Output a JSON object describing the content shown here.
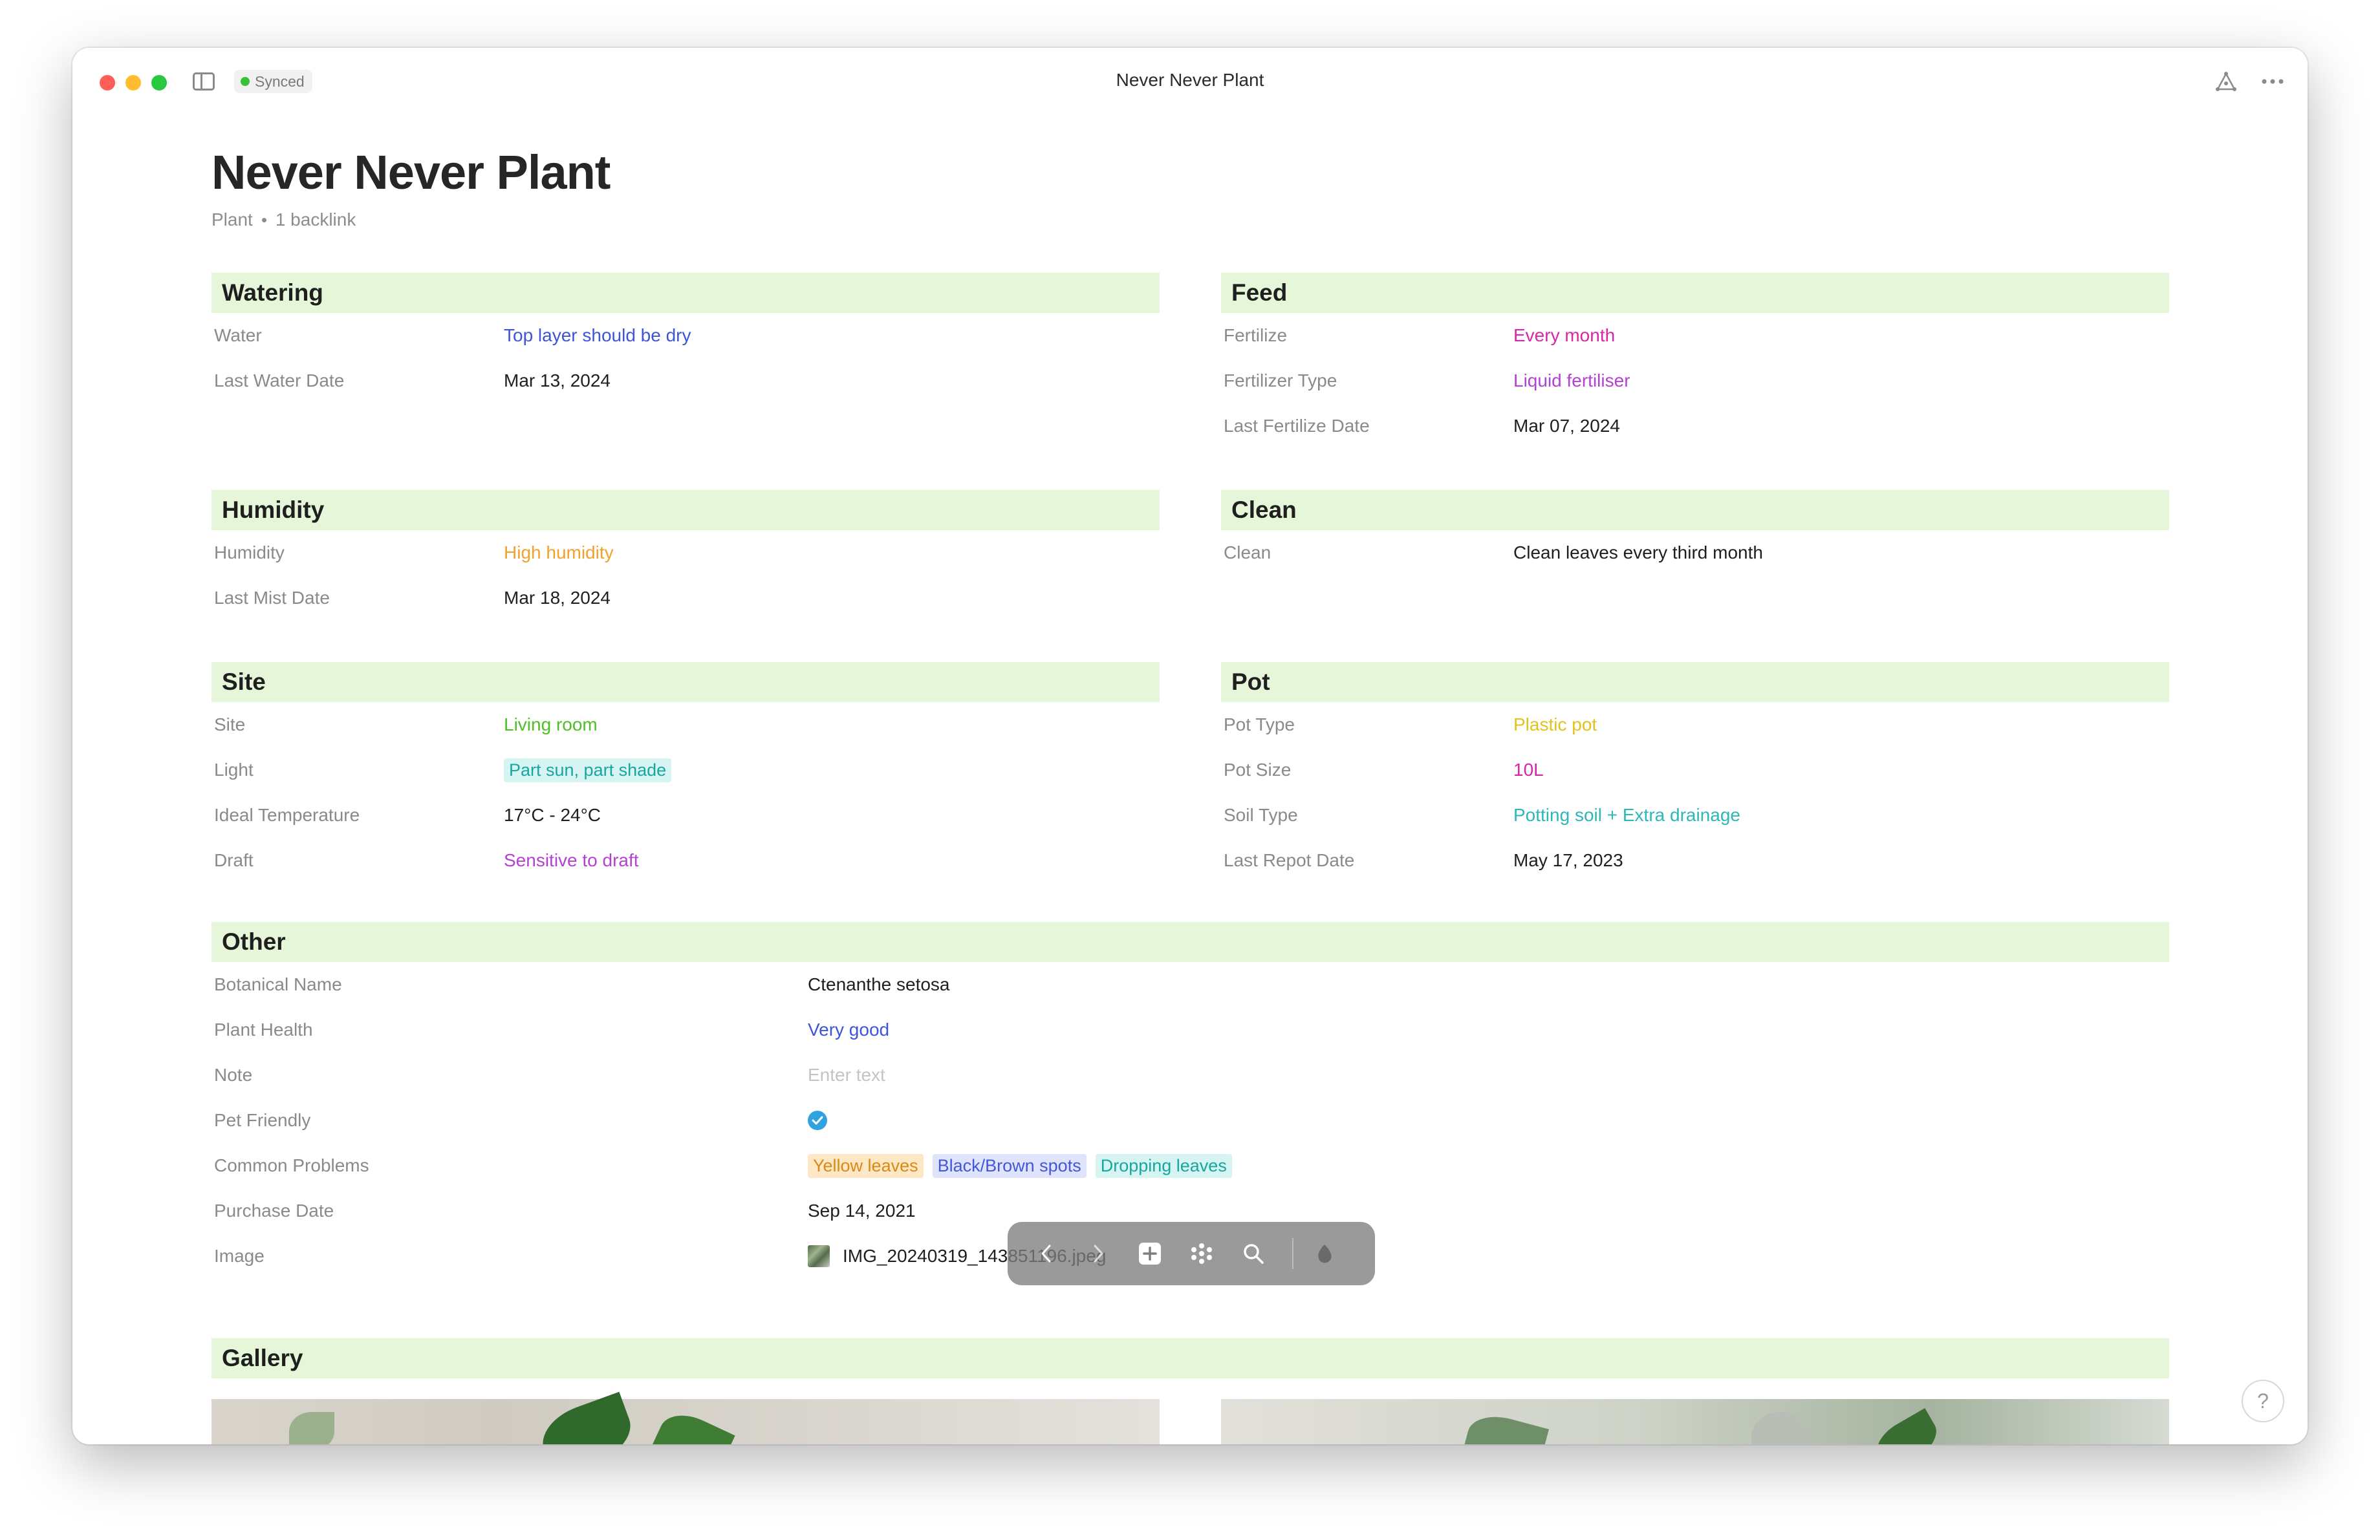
{
  "window": {
    "title": "Never Never Plant",
    "sync_status": "Synced"
  },
  "doc": {
    "title": "Never Never Plant",
    "type": "Plant",
    "backlinks": "1 backlink"
  },
  "watering": {
    "header": "Watering",
    "rows": [
      {
        "label": "Water",
        "value": "Top layer should be dry"
      },
      {
        "label": "Last Water Date",
        "value": "Mar 13, 2024"
      }
    ]
  },
  "feed": {
    "header": "Feed",
    "rows": [
      {
        "label": "Fertilize",
        "value": "Every month"
      },
      {
        "label": "Fertilizer Type",
        "value": "Liquid fertiliser"
      },
      {
        "label": "Last Fertilize Date",
        "value": "Mar 07, 2024"
      }
    ]
  },
  "humidity": {
    "header": "Humidity",
    "rows": [
      {
        "label": "Humidity",
        "value": "High humidity"
      },
      {
        "label": "Last Mist Date",
        "value": "Mar 18, 2024"
      }
    ]
  },
  "clean": {
    "header": "Clean",
    "rows": [
      {
        "label": "Clean",
        "value": "Clean leaves every third month"
      }
    ]
  },
  "site": {
    "header": "Site",
    "rows": [
      {
        "label": "Site",
        "value": "Living room"
      },
      {
        "label": "Light",
        "value": "Part sun, part shade"
      },
      {
        "label": "Ideal Temperature",
        "value": "17°C - 24°C"
      },
      {
        "label": "Draft",
        "value": "Sensitive to draft"
      }
    ]
  },
  "pot": {
    "header": "Pot",
    "rows": [
      {
        "label": "Pot Type",
        "value": "Plastic pot"
      },
      {
        "label": "Pot Size",
        "value": "10L"
      },
      {
        "label": "Soil Type",
        "value": "Potting soil + Extra drainage"
      },
      {
        "label": "Last Repot Date",
        "value": "May 17, 2023"
      }
    ]
  },
  "other": {
    "header": "Other",
    "rows": [
      {
        "label": "Botanical Name",
        "value": "Ctenanthe setosa"
      },
      {
        "label": "Plant Health",
        "value": "Very good"
      },
      {
        "label": "Note",
        "placeholder": "Enter text"
      },
      {
        "label": "Pet Friendly",
        "checked": true
      },
      {
        "label": "Common Problems",
        "tags": [
          "Yellow leaves",
          "Black/Brown spots",
          "Dropping leaves"
        ]
      },
      {
        "label": "Purchase Date",
        "value": "Sep 14, 2021"
      },
      {
        "label": "Image",
        "value": "IMG_20240319_143851196.jpeg"
      }
    ]
  },
  "gallery": {
    "header": "Gallery"
  },
  "colors": {
    "section_header_bg": "#e6f7d9",
    "blue": "#3d55d6",
    "magenta": "#d727a7",
    "purple": "#b441d3",
    "orange": "#f2a22c",
    "green": "#4fbf27",
    "yellow": "#e2c220",
    "teal": "#2cb7b8"
  },
  "icons": {
    "sidebar_toggle": "sidebar-icon",
    "graph": "graph-icon",
    "more": "more-icon",
    "back": "chevron-left-icon",
    "forward": "chevron-right-icon",
    "new": "plus-square-icon",
    "apps": "apps-icon",
    "search": "search-icon",
    "help": "help-icon"
  },
  "help_label": "?"
}
